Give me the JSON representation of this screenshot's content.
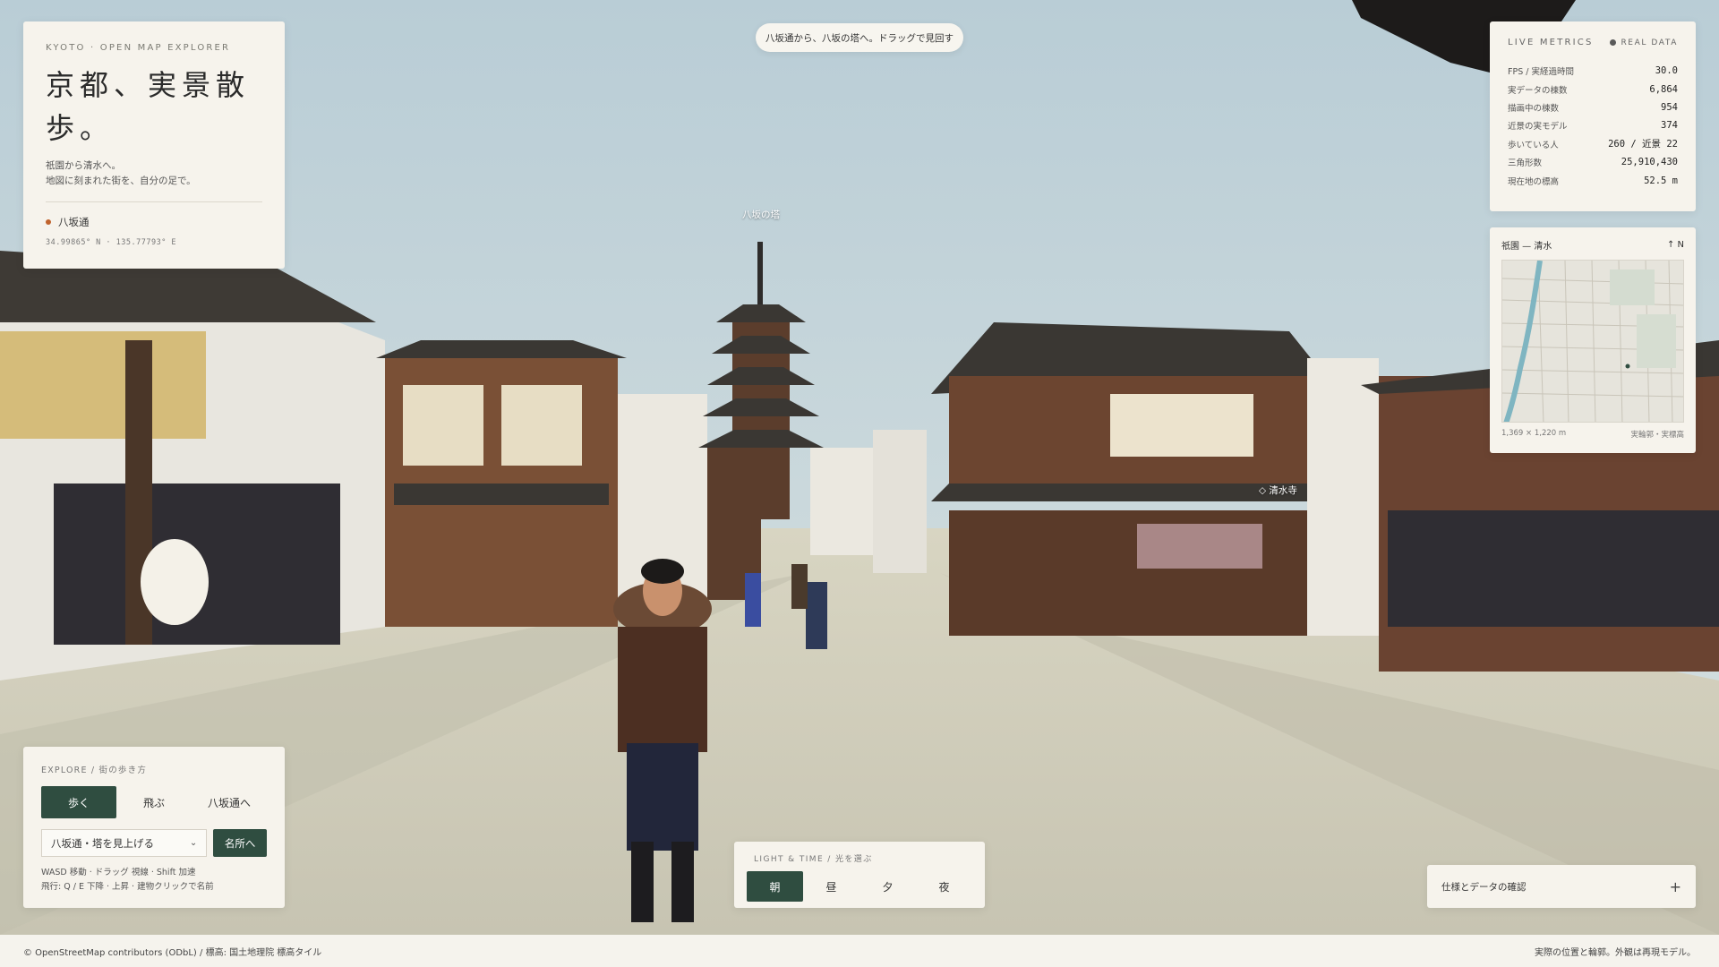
{
  "app": {
    "eyebrow": "KYOTO · OPEN MAP EXPLORER",
    "title": "京都、実景散歩。",
    "subtitle_line1": "祇園から清水へ。",
    "subtitle_line2": "地図に刻まれた街を、自分の足で。",
    "location_name": "八坂通",
    "coords": "34.99865° N · 135.77793° E"
  },
  "hint": "八坂通から、八坂の塔へ。ドラッグで見回す",
  "scene_labels": {
    "pagoda": "八坂の塔",
    "temple": "清水寺"
  },
  "metrics": {
    "title": "LIVE METRICS",
    "badge": "REAL DATA",
    "rows": [
      {
        "label": "FPS / 実経過時間",
        "value": "30.0"
      },
      {
        "label": "実データの棟数",
        "value": "6,864"
      },
      {
        "label": "描画中の棟数",
        "value": "954"
      },
      {
        "label": "近景の実モデル",
        "value": "374"
      },
      {
        "label": "歩いている人",
        "value": "260 / 近景 22"
      },
      {
        "label": "三角形数",
        "value": "25,910,430"
      },
      {
        "label": "現在地の標高",
        "value": "52.5 m"
      }
    ]
  },
  "minimap": {
    "title": "祇園 — 清水",
    "north": "↑ N",
    "size": "1,369 × 1,220 m",
    "legend": "実輪郭・実標高"
  },
  "explore": {
    "title": "EXPLORE / 街の歩き方",
    "modes": [
      "歩く",
      "飛ぶ",
      "八坂通へ"
    ],
    "active_mode": "歩く",
    "spot_value": "八坂通・塔を見上げる",
    "go_label": "名所へ",
    "help_line1": "WASD 移動 · ドラッグ 視線 · Shift 加速",
    "help_line2": "飛行: Q / E 下降 · 上昇 · 建物クリックで名前"
  },
  "light": {
    "title": "LIGHT & TIME / 光を選ぶ",
    "options": [
      "朝",
      "昼",
      "夕",
      "夜"
    ],
    "active": "朝"
  },
  "spec": {
    "label": "仕様とデータの確認",
    "toggle": "+"
  },
  "footer": {
    "left": "© OpenStreetMap contributors (ODbL) / 標高: 国土地理院 標高タイル",
    "right": "実際の位置と輪郭。外観は再現モデル。"
  },
  "colors": {
    "accent": "#2f4d40",
    "panel": "#f6f3ec",
    "location_dot": "#c0632d"
  }
}
